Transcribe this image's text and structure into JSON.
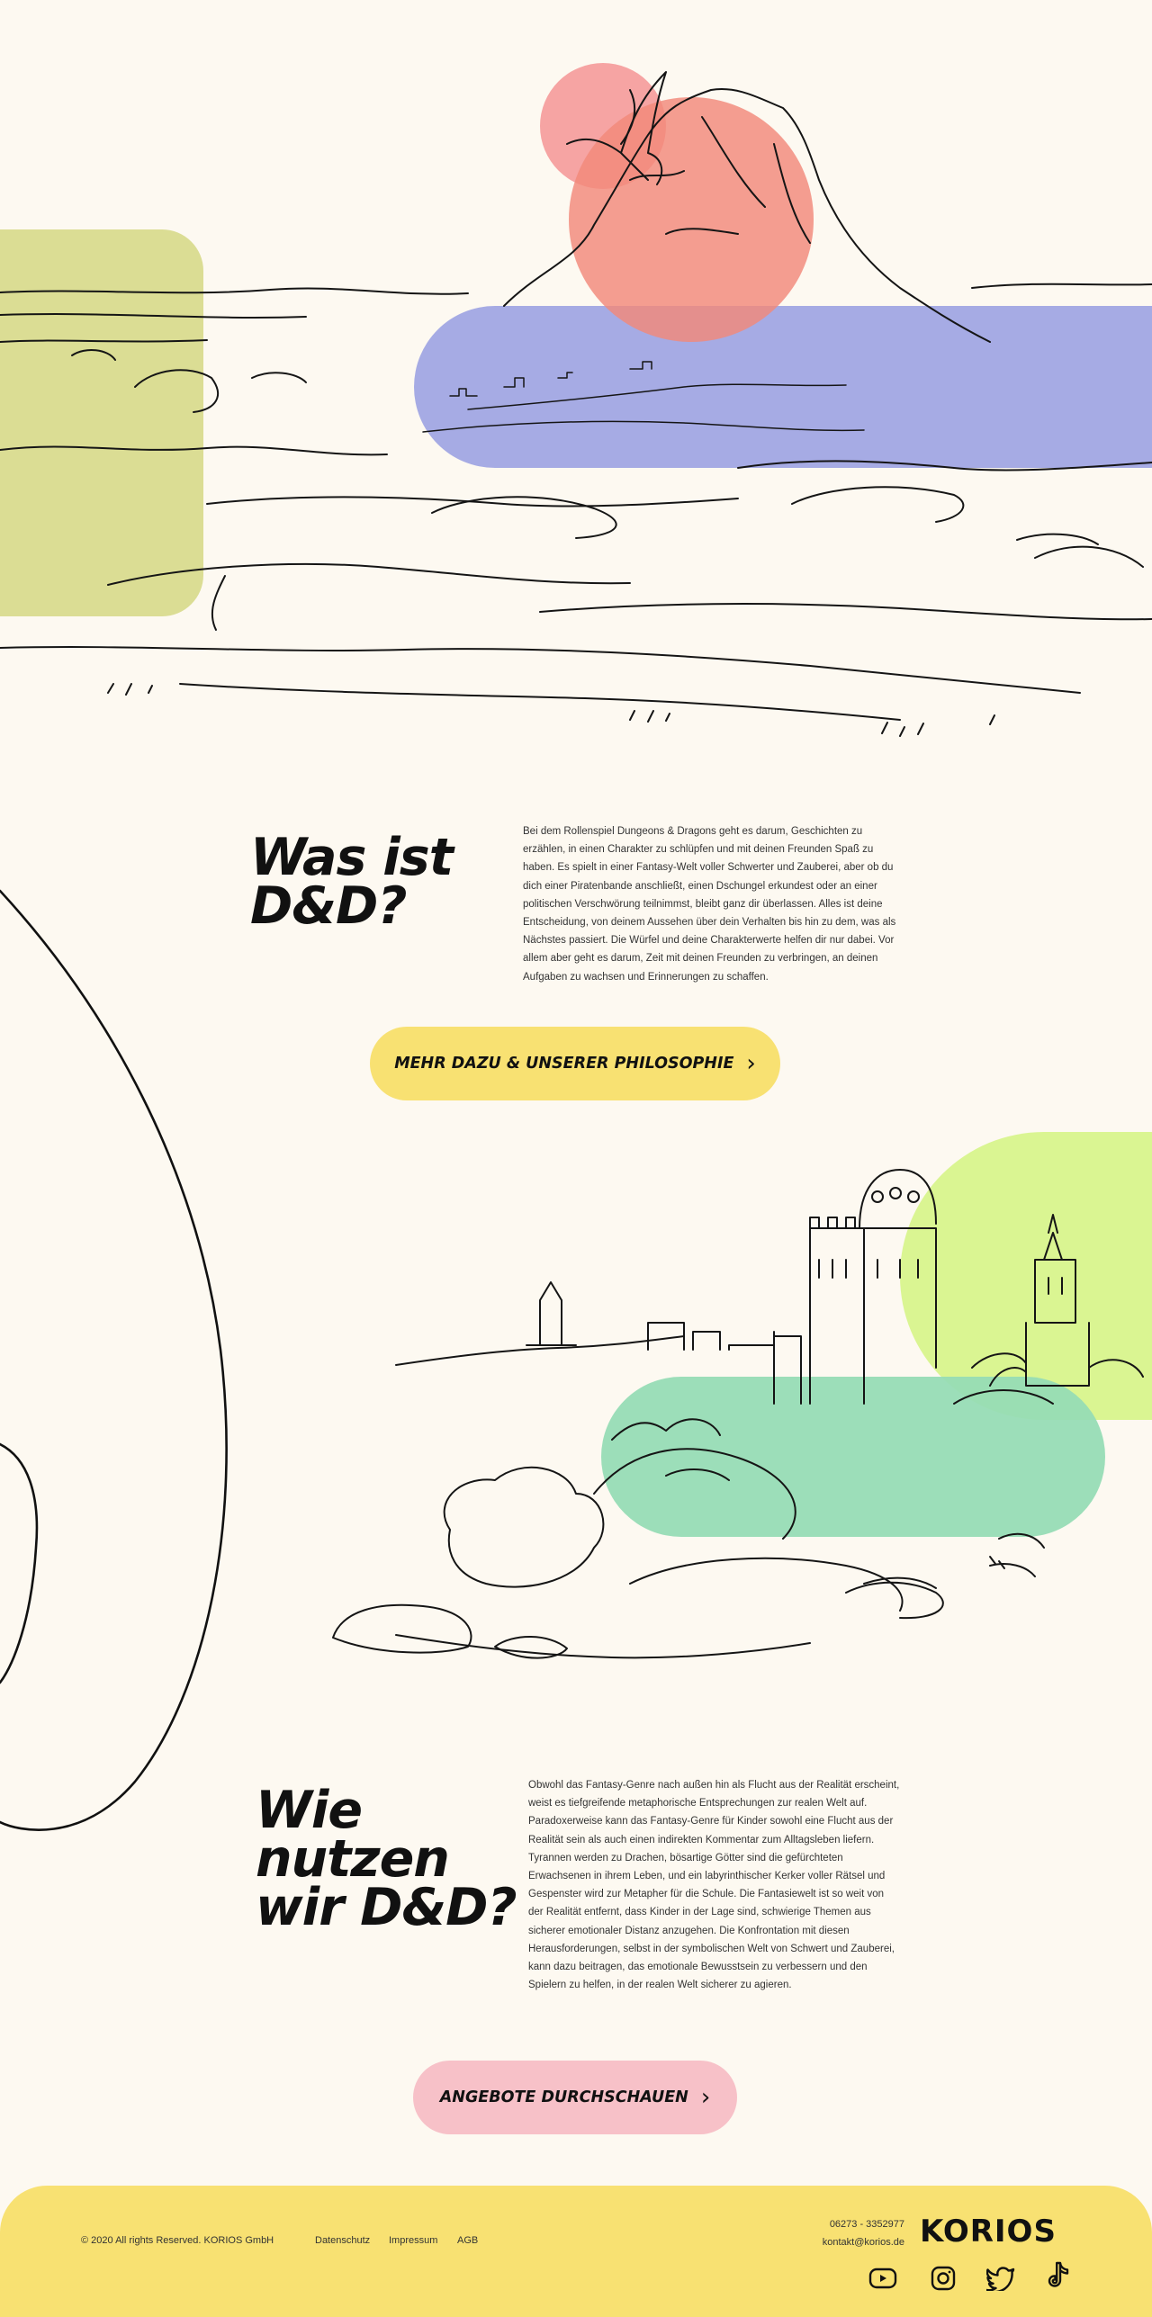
{
  "colors": {
    "background": "#fdf9f1",
    "accent_yellow": "#f8e172",
    "accent_pink": "#f7c1c8",
    "blob_olive": "#d7d98a",
    "blob_red": "#f2897a",
    "blob_blue": "#a1a6e3",
    "blob_lime": "#d8f48c",
    "blob_green": "#97dcb5"
  },
  "hero": {
    "illustration": "landscape-with-mountain-and-sea"
  },
  "section1": {
    "heading_line1": "Was ist",
    "heading_line2": "D&D?",
    "body": "Bei dem Rollenspiel Dungeons & Dragons geht es darum, Geschichten zu erzählen, in einen Charakter zu schlüpfen und mit deinen Freunden Spaß zu haben. Es spielt in einer Fantasy-Welt voller Schwerter und Zauberei, aber ob du dich einer Piratenbande anschließt, einen Dschungel erkundest oder an einer politischen Verschwörung teilnimmst, bleibt ganz dir überlassen. Alles ist deine Entscheidung, von deinem Aussehen über dein Verhalten bis hin zu dem, was als Nächstes passiert. Die Würfel und deine Charakterwerte helfen dir nur dabei. Vor allem aber geht es darum, Zeit mit deinen Freunden zu verbringen, an deinen Aufgaben zu wachsen und Erinnerungen zu schaffen.",
    "cta_label": "MEHR DAZU & UNSERER PHILOSOPHIE",
    "cta_icon": "chevron-right-icon"
  },
  "castle": {
    "illustration": "fantasy-castle-on-rocks"
  },
  "section2": {
    "heading_line1": "Wie",
    "heading_line2": "nutzen",
    "heading_line3": "wir D&D?",
    "body": "Obwohl das Fantasy-Genre nach außen hin als Flucht aus der Realität erscheint, weist es tiefgreifende metaphorische Entsprechungen zur realen Welt auf. Paradoxerweise kann das Fantasy-Genre für Kinder sowohl eine Flucht aus der Realität sein als auch einen indirekten Kommentar zum Alltagsleben liefern. Tyrannen werden zu Drachen, bösartige Götter sind die gefürchteten Erwachsenen in ihrem Leben, und ein labyrinthischer Kerker voller Rätsel und Gespenster wird zur Metapher für die Schule. Die Fantasiewelt ist so weit von der Realität entfernt, dass Kinder in der Lage sind, schwierige Themen aus sicherer emotionaler Distanz anzugehen. Die Konfrontation mit diesen Herausforderungen, selbst in der symbolischen Welt von Schwert und Zauberei, kann dazu beitragen, das emotionale Bewusstsein zu verbessern und den Spielern zu helfen, in der realen Welt sicherer zu agieren.",
    "cta_label": "ANGEBOTE DURCHSCHAUEN",
    "cta_icon": "chevron-right-icon"
  },
  "footer": {
    "copyright": "© 2020 All rights Reserved. KORIOS GmbH",
    "links": [
      "Datenschutz",
      "Impressum",
      "AGB"
    ],
    "phone": "06273 - 3352977",
    "email": "kontakt@korios.de",
    "logo_text": "KORIOS",
    "social": [
      "youtube-icon",
      "instagram-icon",
      "twitter-icon",
      "tiktok-icon"
    ]
  }
}
